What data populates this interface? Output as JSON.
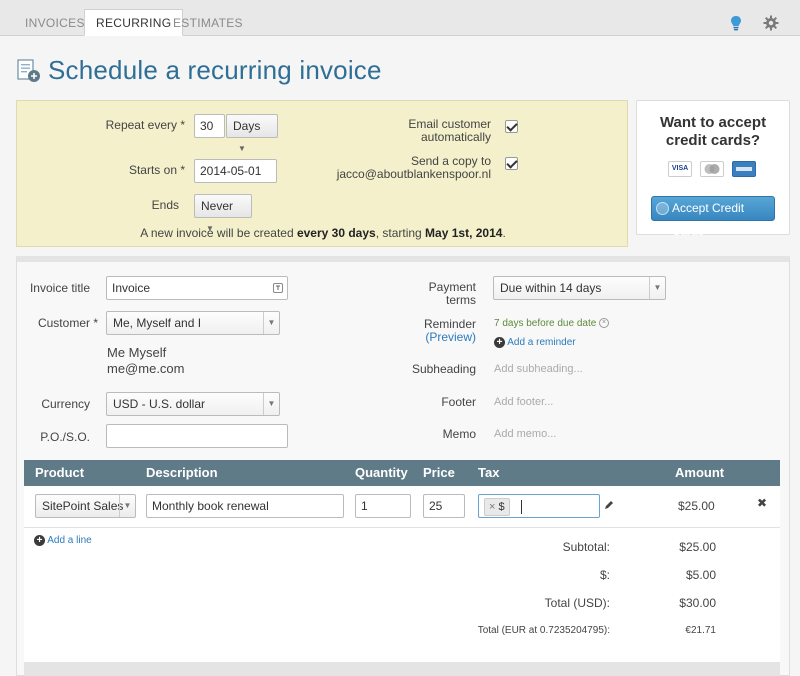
{
  "tabs": [
    {
      "label": "INVOICES"
    },
    {
      "label": "RECURRING"
    },
    {
      "label": "ESTIMATES"
    }
  ],
  "header": {
    "title": "Schedule a recurring invoice"
  },
  "schedule": {
    "repeat_label": "Repeat every *",
    "repeat_value": "30",
    "repeat_unit": "Days",
    "starts_label": "Starts on *",
    "starts_value": "2014-05-01",
    "ends_label": "Ends",
    "ends_value": "Never",
    "email_label_1": "Email customer",
    "email_label_2": "automatically",
    "copy_label_1": "Send a copy to",
    "copy_label_2": "jacco@aboutblankenspoor.nl",
    "summary_pre": "A new invoice will be created ",
    "summary_b1": "every 30 days",
    "summary_mid": ", starting ",
    "summary_b2": "May 1st, 2014",
    "summary_post": "."
  },
  "credit": {
    "title_1": "Want to accept",
    "title_2": "credit cards?",
    "button": "Accept Credit Cards",
    "cards": [
      "VISA",
      "MC",
      "AMEX"
    ]
  },
  "form": {
    "invoice_title_label": "Invoice title",
    "invoice_title_value": "Invoice",
    "customer_label": "Customer *",
    "customer_value": "Me, Myself and I",
    "customer_name": "Me Myself",
    "customer_email": "me@me.com",
    "currency_label": "Currency",
    "currency_value": "USD - U.S. dollar",
    "po_label": "P.O./S.O.",
    "po_value": "",
    "payment_label_1": "Payment",
    "payment_label_2": "terms",
    "payment_value": "Due within 14 days",
    "reminder_label": "Reminder",
    "reminder_preview": "(Preview)",
    "reminder_value": "7 days before due date",
    "add_reminder": "Add a reminder",
    "subheading_label": "Subheading",
    "subheading_placeholder": "Add subheading...",
    "footer_label": "Footer",
    "footer_placeholder": "Add footer...",
    "memo_label": "Memo",
    "memo_placeholder": "Add memo..."
  },
  "table": {
    "headers": {
      "product": "Product",
      "description": "Description",
      "quantity": "Quantity",
      "price": "Price",
      "tax": "Tax",
      "amount": "Amount"
    },
    "row": {
      "product": "SitePoint Sales",
      "description": "Monthly book renewal",
      "quantity": "1",
      "price": "25",
      "tax_tag": "$",
      "amount": "$25.00"
    },
    "add_line": "Add a line"
  },
  "totals": {
    "subtotal_label": "Subtotal:",
    "subtotal_value": "$25.00",
    "tax_label": "$:",
    "tax_value": "$5.00",
    "total_label": "Total (USD):",
    "total_value": "$30.00",
    "converted_label": "Total (EUR at 0.7235204795):",
    "converted_value": "€21.71"
  },
  "colors": {
    "accent": "#2f6f95",
    "schedule_bg": "#f3f0cb",
    "table_header": "#607b88",
    "button": "#3786c0"
  }
}
